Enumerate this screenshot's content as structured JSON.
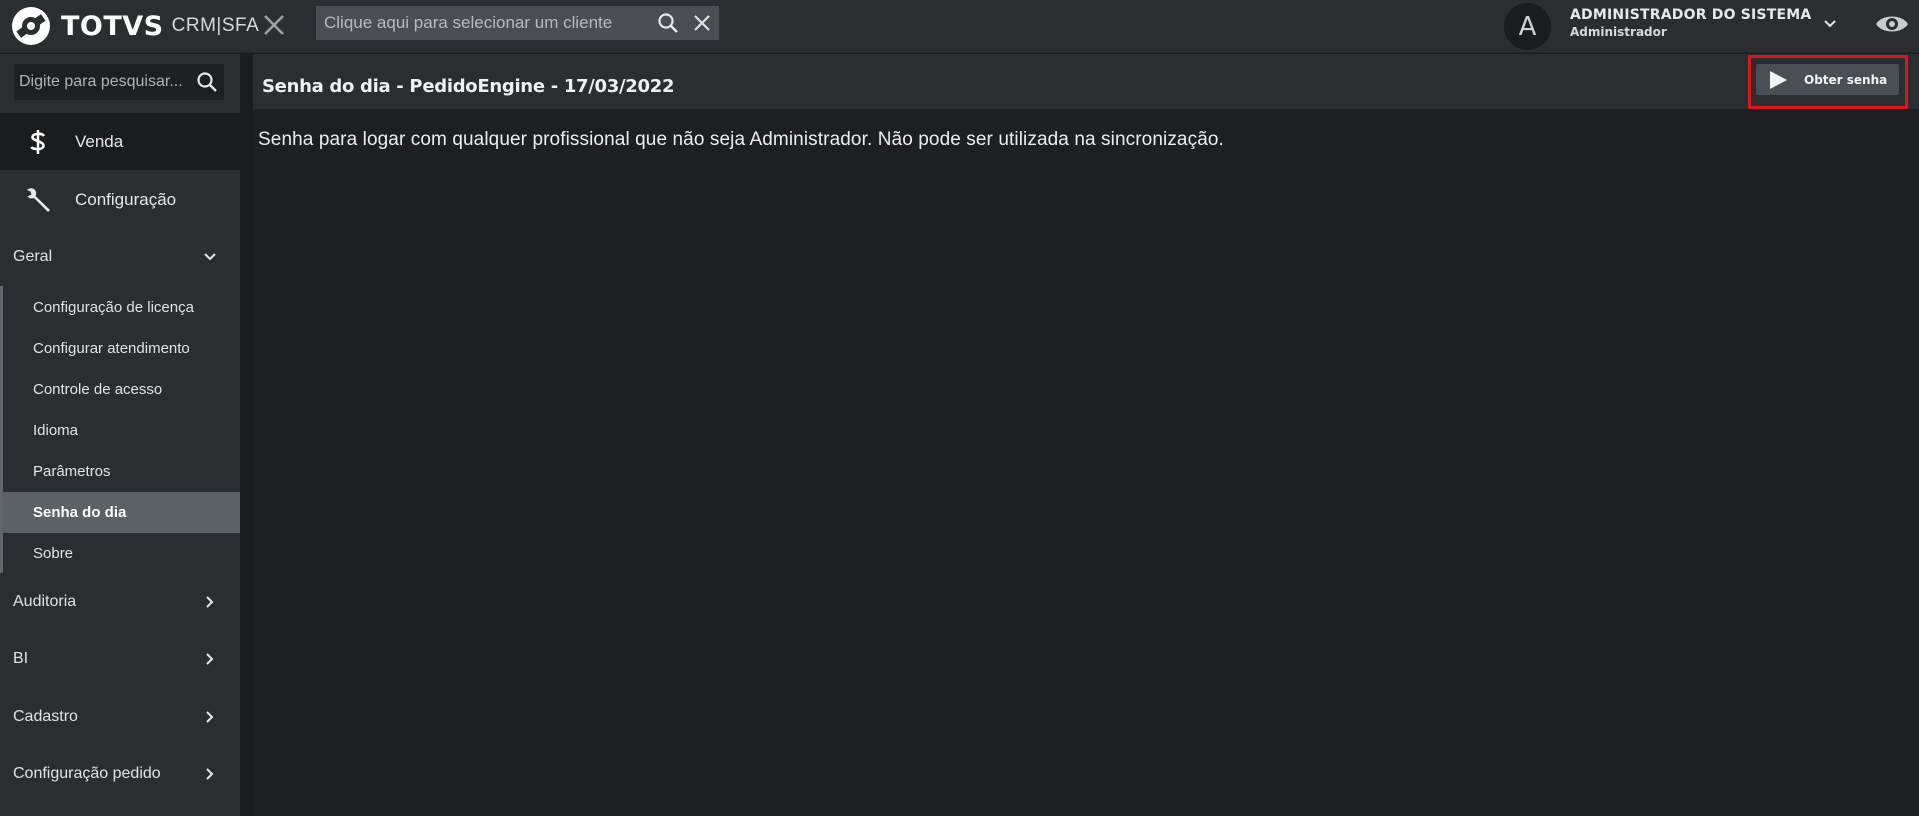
{
  "topbar": {
    "brand": "TOTVS",
    "product": "CRM|SFA",
    "client_search": {
      "placeholder": "Clique aqui para selecionar um cliente",
      "value": ""
    },
    "user": {
      "initial": "A",
      "name": "ADMINISTRADOR DO SISTEMA",
      "role": "Administrador"
    }
  },
  "sidebar": {
    "search": {
      "placeholder": "Digite para pesquisar...",
      "value": ""
    },
    "main_items": [
      {
        "label": "Venda",
        "icon": "dollar-icon"
      },
      {
        "label": "Configuração",
        "icon": "wrench-icon"
      }
    ],
    "sections": {
      "geral": {
        "label": "Geral",
        "items": [
          {
            "label": "Configuração de licença"
          },
          {
            "label": "Configurar atendimento"
          },
          {
            "label": "Controle de acesso"
          },
          {
            "label": "Idioma"
          },
          {
            "label": "Parâmetros"
          },
          {
            "label": "Senha do dia",
            "active": true
          },
          {
            "label": "Sobre"
          }
        ]
      },
      "collapsed": [
        {
          "label": "Auditoria"
        },
        {
          "label": "BI"
        },
        {
          "label": "Cadastro"
        },
        {
          "label": "Configuração pedido"
        }
      ]
    }
  },
  "content": {
    "title": "Senha do dia - PedidoEngine - 17/03/2022",
    "action_button": {
      "label": "Obter senha",
      "icon": "play-icon"
    },
    "description": "Senha para logar com qualquer profissional que não seja Administrador. Não pode ser utilizada na sincronização."
  },
  "colors": {
    "topbar_bg": "#2b2e31",
    "content_bg": "#1d1f22",
    "active_item_bg": "#5c6166",
    "highlight_border": "#e0141e"
  }
}
